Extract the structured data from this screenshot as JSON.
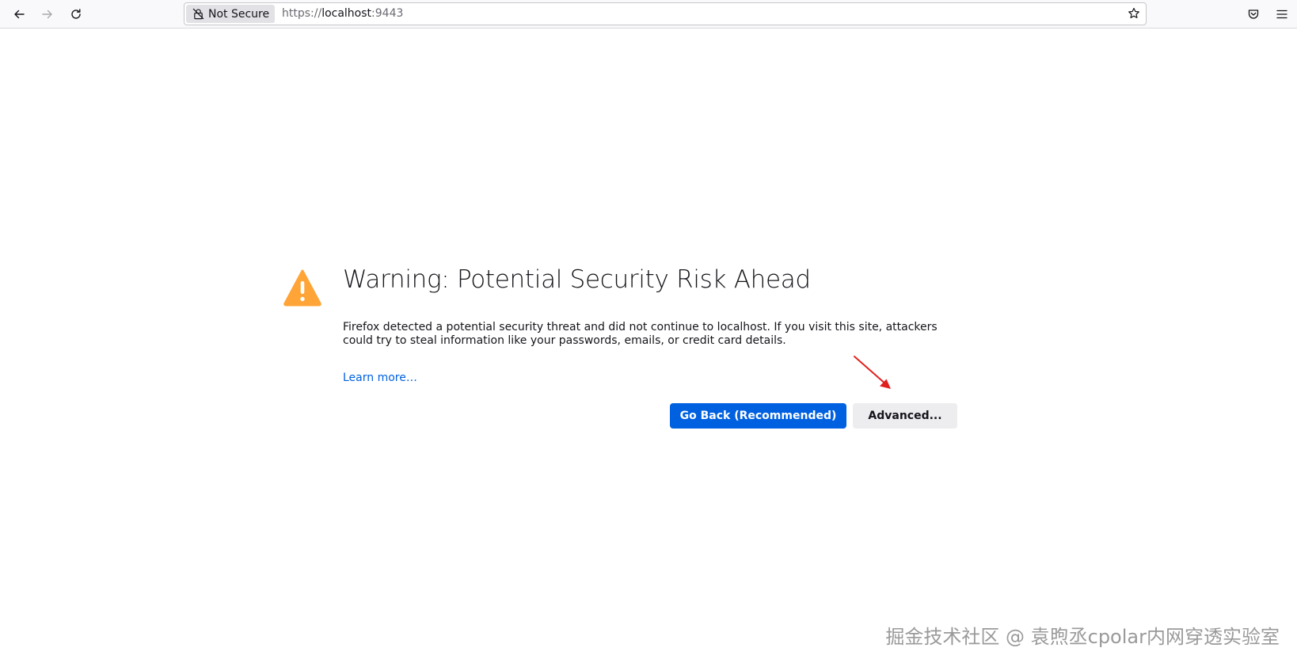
{
  "toolbar": {
    "back_icon": "arrow-left-icon",
    "forward_icon": "arrow-right-icon",
    "reload_icon": "reload-icon",
    "identity_label": "Not Secure",
    "url_scheme": "https://",
    "url_host": "localhost",
    "url_port": ":9443",
    "bookmark_icon": "star-icon",
    "pocket_icon": "pocket-icon",
    "menu_icon": "hamburger-menu-icon"
  },
  "error_page": {
    "title": "Warning: Potential Security Risk Ahead",
    "description": "Firefox detected a potential security threat and did not continue to localhost. If you visit this site, attackers could try to steal information like your passwords, emails, or credit card details.",
    "learn_more": "Learn more…",
    "go_back_label": "Go Back (Recommended)",
    "advanced_label": "Advanced..."
  },
  "watermark": "掘金技术社区 @ 袁煦丞cpolar内网穿透实验室",
  "colors": {
    "accent": "#0061e0",
    "warning": "#ffa436",
    "annotation_arrow": "#e02020"
  }
}
